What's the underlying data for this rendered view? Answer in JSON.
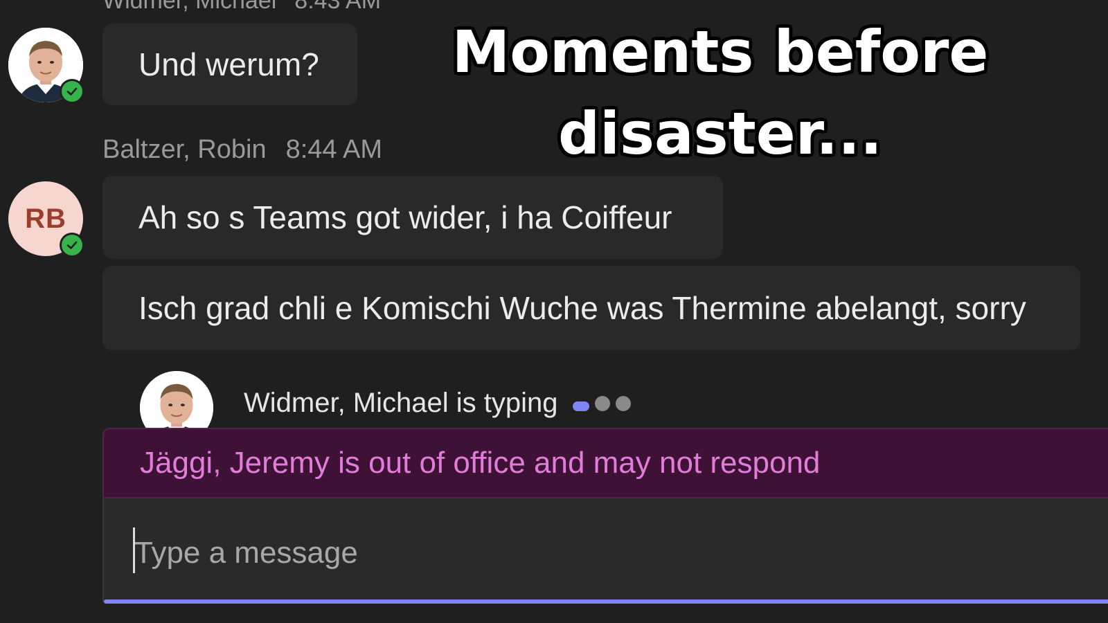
{
  "messages": {
    "prev_header": {
      "sender": "Widmer, Michael",
      "time": "8:43 AM"
    },
    "msg1": {
      "text": "Und werum?"
    },
    "group2": {
      "sender": "Baltzer, Robin",
      "time": "8:44 AM",
      "avatar_initials": "RB",
      "msg2": "Ah so s Teams got wider, i ha Coiffeur",
      "msg3": "Isch grad chli e Komischi Wuche was Thermine abelangt, sorry"
    }
  },
  "typing": {
    "text": "Widmer, Michael is typing"
  },
  "out_of_office": {
    "text": "Jäggi, Jeremy is out of office and may not respond"
  },
  "composer": {
    "placeholder": "Type a message"
  },
  "caption": {
    "line1": "Moments before",
    "line2": "disaster..."
  },
  "icons": {
    "status_available": "check-circle-icon",
    "typing_indicator": "typing-dots-icon"
  },
  "colors": {
    "background": "#1f1f1f",
    "bubble": "#292929",
    "accent": "#7f85f5",
    "available_green": "#36b34a",
    "ooo_background": "#3d1236",
    "ooo_text": "#e27cd9",
    "rb_avatar_bg": "#f6d6cf",
    "rb_avatar_text": "#9a3d2d"
  }
}
